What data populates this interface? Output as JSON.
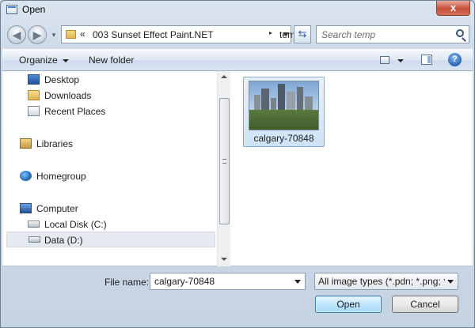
{
  "window": {
    "title": "Open",
    "close_glyph": "x"
  },
  "address": {
    "chevrons": "«",
    "crumbs": [
      "003 Sunset Effect Paint.NET",
      "temp"
    ],
    "separator": "▸"
  },
  "search": {
    "placeholder": "Search temp"
  },
  "toolbar": {
    "organize_label": "Organize",
    "new_folder_label": "New folder",
    "help_glyph": "?"
  },
  "nav_pane": {
    "items": [
      {
        "label": "Desktop",
        "icon": "desktop-icon"
      },
      {
        "label": "Downloads",
        "icon": "downloads-folder-icon"
      },
      {
        "label": "Recent Places",
        "icon": "recent-places-icon"
      },
      {
        "label": "Libraries",
        "icon": "libraries-icon"
      },
      {
        "label": "Homegroup",
        "icon": "homegroup-icon"
      },
      {
        "label": "Computer",
        "icon": "computer-icon"
      },
      {
        "label": "Local Disk (C:)",
        "icon": "local-disk-icon"
      },
      {
        "label": "Data (D:)",
        "icon": "drive-icon",
        "selected": true
      }
    ]
  },
  "files": [
    {
      "name": "calgary-70848",
      "selected": true
    }
  ],
  "footer": {
    "file_name_label": "File name:",
    "file_name_value": "calgary-70848",
    "file_type_value": "All image types (*.pdn; *.png; *",
    "open_label": "Open",
    "cancel_label": "Cancel"
  },
  "colors": {
    "selection": "#cde3f6",
    "accent": "#3c7fb1"
  }
}
